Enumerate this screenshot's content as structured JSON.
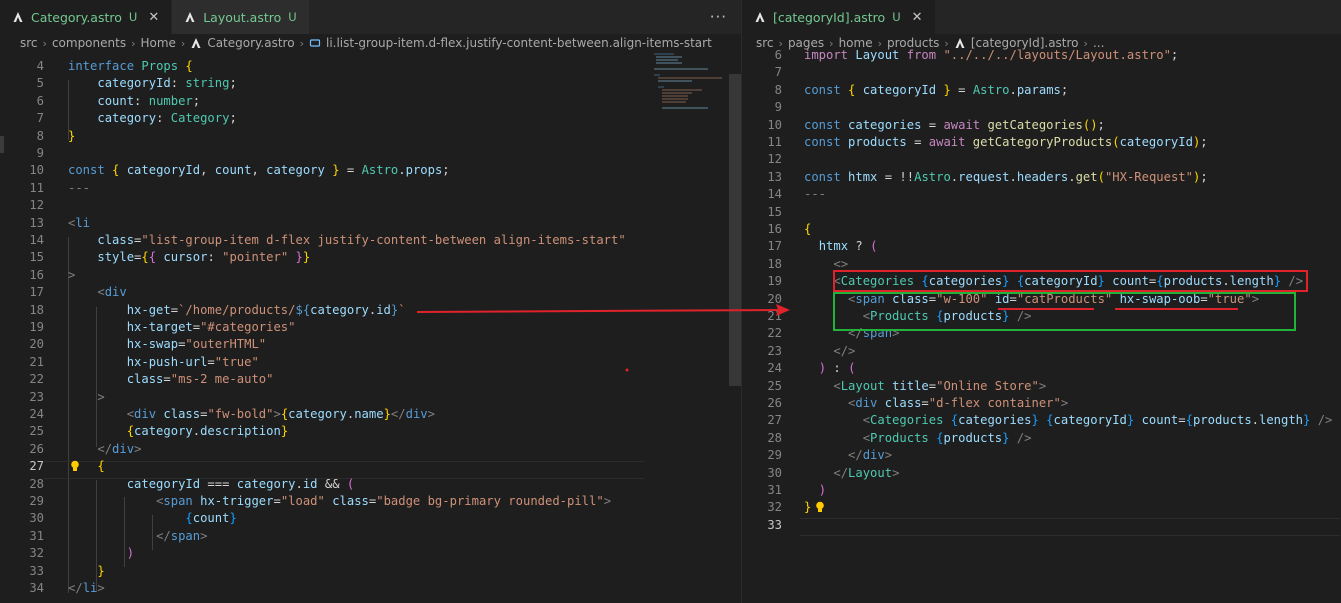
{
  "left": {
    "tabs": [
      {
        "label": "Category.astro",
        "status": "U",
        "active": true
      },
      {
        "label": "Layout.astro",
        "status": "U",
        "active": false
      }
    ],
    "more_actions": "···",
    "breadcrumb": [
      "src",
      "components",
      "Home",
      "Category.astro",
      "li.list-group-item.d-flex.justify-content-between.align-items-start"
    ],
    "current_line": "27"
  },
  "right": {
    "tabs": [
      {
        "label": "[categoryId].astro",
        "status": "U",
        "active": true
      }
    ],
    "breadcrumb": [
      "src",
      "pages",
      "home",
      "products",
      "[categoryId].astro",
      "..."
    ]
  },
  "icons": [
    "astro-icon",
    "close-icon",
    "more-actions-icon",
    "chevron-right-icon",
    "element-icon",
    "lightbulb-icon"
  ],
  "colors": {
    "annotation_red": "#e0222a",
    "annotation_green": "#21b33a",
    "keyword": "#569cd6",
    "string": "#ce9178",
    "variable": "#9cdcfe",
    "type": "#4ec9b0"
  }
}
